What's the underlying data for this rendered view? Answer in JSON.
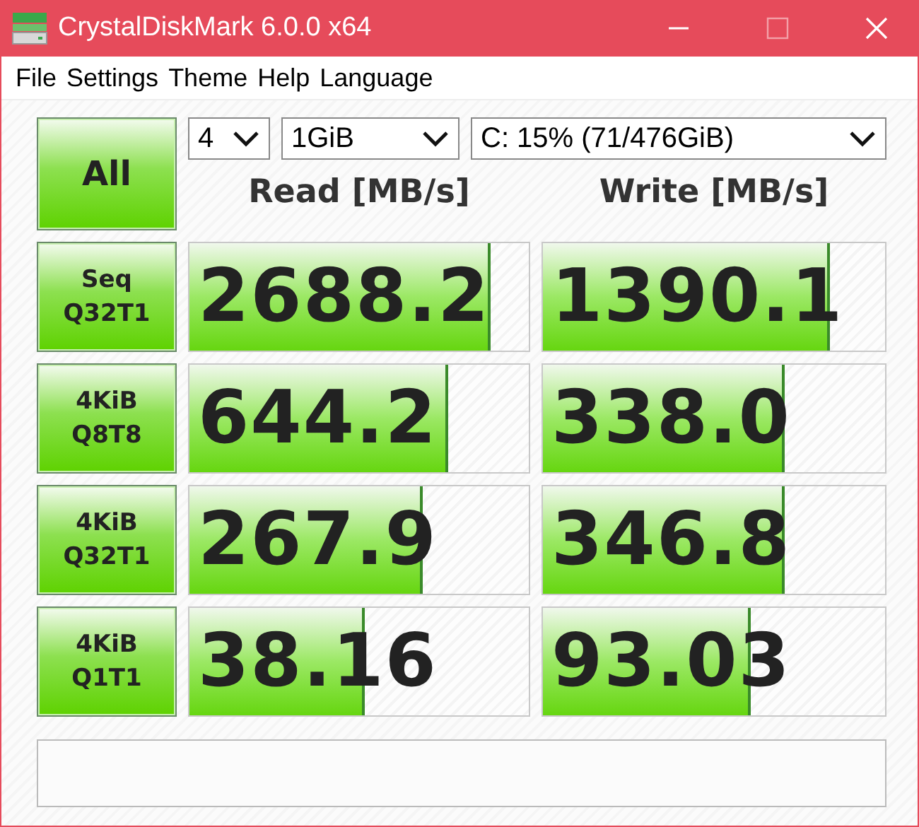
{
  "window": {
    "title": "CrystalDiskMark 6.0.0 x64"
  },
  "menu": [
    "File",
    "Settings",
    "Theme",
    "Help",
    "Language"
  ],
  "all_button": "All",
  "selectors": [
    {
      "value": "4"
    },
    {
      "value": "1GiB"
    },
    {
      "value": "C: 15% (71/476GiB)"
    }
  ],
  "headers": [
    "Read [MB/s]",
    "Write [MB/s]"
  ],
  "tests": [
    {
      "label": "Seq\nQ32T1",
      "read": {
        "value": "2688.2",
        "level": 0.88
      },
      "write": {
        "value": "1390.1",
        "level": 0.83
      }
    },
    {
      "label": "4KiB\nQ8T8",
      "read": {
        "value": "644.2",
        "level": 0.755
      },
      "write": {
        "value": "338.0",
        "level": 0.7
      }
    },
    {
      "label": "4KiB\nQ32T1",
      "read": {
        "value": "267.9",
        "level": 0.68
      },
      "write": {
        "value": "346.8",
        "level": 0.7
      }
    },
    {
      "label": "4KiB\nQ1T1",
      "read": {
        "value": "38.16",
        "level": 0.51
      },
      "write": {
        "value": "93.03",
        "level": 0.6
      }
    }
  ]
}
